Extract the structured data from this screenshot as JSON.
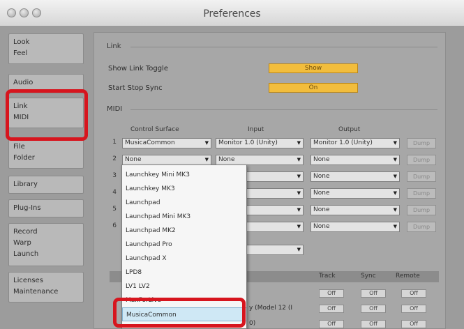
{
  "window": {
    "title": "Preferences"
  },
  "sidebar": {
    "items": [
      {
        "lines": [
          "Look",
          "Feel"
        ]
      },
      {
        "lines": [
          "Audio"
        ]
      },
      {
        "lines": [
          "Link",
          "MIDI"
        ]
      },
      {
        "lines": [
          "File",
          "Folder"
        ]
      },
      {
        "lines": [
          "Library"
        ]
      },
      {
        "lines": [
          "Plug-Ins"
        ]
      },
      {
        "lines": [
          "Record",
          "Warp",
          "Launch"
        ]
      },
      {
        "lines": [
          "Licenses",
          "Maintenance"
        ]
      }
    ]
  },
  "link": {
    "section": "Link",
    "show_toggle_label": "Show Link Toggle",
    "show_toggle_value": "Show",
    "start_stop_label": "Start Stop Sync",
    "start_stop_value": "On"
  },
  "midi": {
    "section": "MIDI",
    "headers": {
      "surface": "Control Surface",
      "input": "Input",
      "output": "Output"
    },
    "rows": [
      {
        "num": "1",
        "surface": "MusicaCommon",
        "input": "Monitor 1.0 (Unity)",
        "output": "Monitor 1.0 (Unity)",
        "dump": "Dump"
      },
      {
        "num": "2",
        "surface": "None",
        "input": "None",
        "output": "None",
        "dump": "Dump"
      },
      {
        "num": "3",
        "surface": "",
        "input": "",
        "output": "None",
        "dump": "Dump"
      },
      {
        "num": "4",
        "surface": "",
        "input": "",
        "output": "None",
        "dump": "Dump"
      },
      {
        "num": "5",
        "surface": "",
        "input": "",
        "output": "None",
        "dump": "Dump"
      },
      {
        "num": "6",
        "surface": "",
        "input": "",
        "output": "None",
        "dump": "Dump"
      }
    ],
    "takeover_value": "",
    "ports_headers": {
      "track": "Track",
      "sync": "Sync",
      "remote": "Remote"
    },
    "ports_row2_text": "y (Model 12 (I",
    "ports_row3_text": "0)",
    "toggle_off": "Off"
  },
  "dropdown": {
    "options": [
      "Launchkey Mini MK3",
      "Launchkey MK3",
      "Launchpad",
      "Launchpad Mini MK3",
      "Launchpad MK2",
      "Launchpad Pro",
      "Launchpad X",
      "LPD8",
      "LV1 LV2",
      "MaxForLive",
      "MusicaCommon"
    ],
    "selected": "MusicaCommon"
  },
  "colors": {
    "accent_yellow": "#f2bd3c",
    "highlight_red": "#d7151e",
    "selection_blue": "#cfe8f5"
  }
}
